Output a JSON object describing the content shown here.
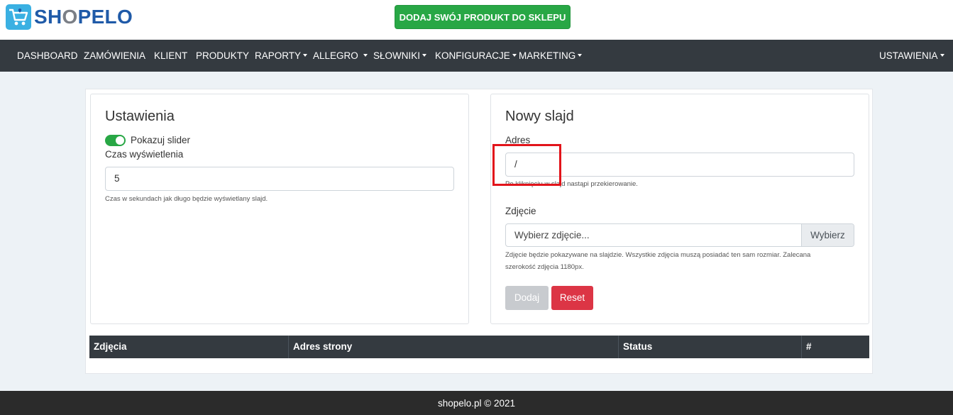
{
  "app": {
    "logo_text_1": "SH",
    "logo_text_o": "O",
    "logo_text_2": "PELO",
    "cta_label": "DODAJ SWÓJ PRODUKT DO SKLEPU"
  },
  "nav": {
    "items": [
      {
        "label": "DASHBOARD",
        "dropdown": false
      },
      {
        "label": "ZAMÓWIENIA",
        "dropdown": false
      },
      {
        "label": "KLIENT",
        "dropdown": false
      },
      {
        "label": "PRODUKTY",
        "dropdown": false
      },
      {
        "label": "RAPORTY",
        "dropdown": true
      },
      {
        "label": "ALLEGRO",
        "dropdown": true
      },
      {
        "label": "SŁOWNIKI",
        "dropdown": true
      },
      {
        "label": "KONFIGURACJE",
        "dropdown": true
      },
      {
        "label": "MARKETING",
        "dropdown": true
      }
    ],
    "settings_label": "USTAWIENIA"
  },
  "settings": {
    "title": "Ustawienia",
    "show_slider_label": "Pokazuj slider",
    "show_slider_on": true,
    "display_time_label": "Czas wyświetlenia",
    "display_time_value": "5",
    "display_time_help": "Czas w sekundach jak długo będzie wyświetlany slajd."
  },
  "new_slide": {
    "title": "Nowy slajd",
    "address_label": "Adres",
    "address_value": "/",
    "address_help": "Po kliknięciu w slajd nastąpi przekierowanie.",
    "image_label": "Zdjęcie",
    "image_placeholder": "Wybierz zdjęcie...",
    "browse_label": "Wybierz",
    "image_help_1": "Zdjęcie będzie pokazywane na slajdzie. Wszystkie zdjęcia muszą posiadać ten sam rozmiar. Zalecana",
    "image_help_2": "szerokość zdjęcia 1180px.",
    "add_label": "Dodaj",
    "reset_label": "Reset"
  },
  "table": {
    "headers": [
      "Zdjęcia",
      "Adres strony",
      "Status",
      "#"
    ]
  },
  "footer": {
    "text": "shopelo.pl © 2021"
  },
  "colors": {
    "nav_bg": "#343a40",
    "cta_green": "#28a745",
    "reset_red": "#dc3545",
    "highlight_red": "#e2141b",
    "page_bg": "#edf2f6"
  }
}
